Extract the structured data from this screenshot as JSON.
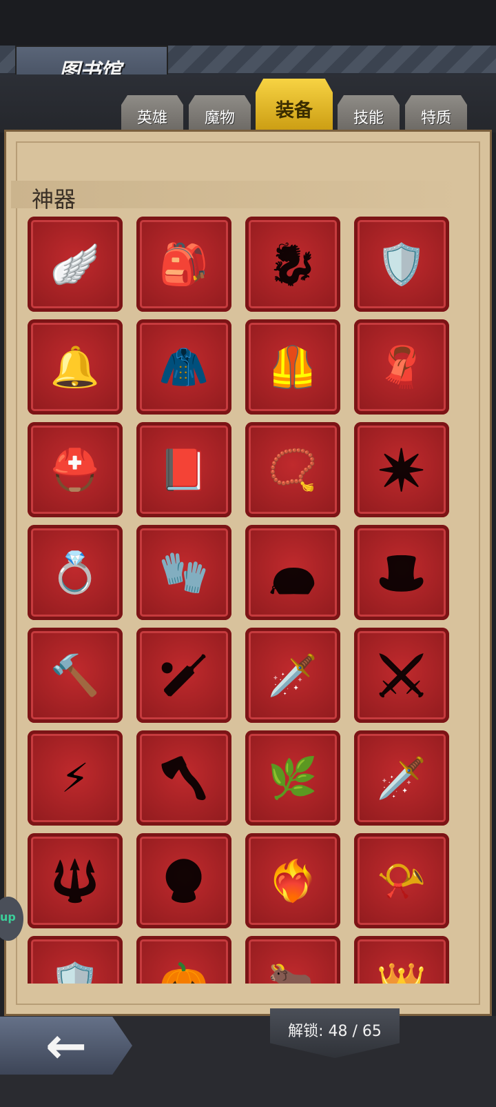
{
  "header": {
    "title": "图书馆"
  },
  "tabs": [
    {
      "label": "英雄",
      "active": false
    },
    {
      "label": "魔物",
      "active": false
    },
    {
      "label": "装备",
      "active": true
    },
    {
      "label": "技能",
      "active": false
    },
    {
      "label": "特质",
      "active": false
    }
  ],
  "section": {
    "title": "神器"
  },
  "items": [
    {
      "name": "winged-staff",
      "locked": false,
      "glyph": "🪽"
    },
    {
      "name": "backpack",
      "locked": false,
      "glyph": "🎒"
    },
    {
      "name": "dragon-silhouette",
      "locked": true,
      "glyph": "🐉"
    },
    {
      "name": "crystal-shield",
      "locked": false,
      "glyph": "🛡️"
    },
    {
      "name": "silver-bell",
      "locked": false,
      "glyph": "🔔"
    },
    {
      "name": "golden-hood",
      "locked": false,
      "glyph": "🧥"
    },
    {
      "name": "fur-armor",
      "locked": false,
      "glyph": "🦺"
    },
    {
      "name": "mantle",
      "locked": false,
      "glyph": "🧣"
    },
    {
      "name": "golden-helm",
      "locked": false,
      "glyph": "⛑️"
    },
    {
      "name": "gem-book",
      "locked": false,
      "glyph": "📕"
    },
    {
      "name": "ruby-amulet",
      "locked": false,
      "glyph": "📿"
    },
    {
      "name": "shuriken-silhouette",
      "locked": true,
      "glyph": "✴️"
    },
    {
      "name": "gem-ring",
      "locked": false,
      "glyph": "💍"
    },
    {
      "name": "spirit-gauntlet",
      "locked": false,
      "glyph": "🧤"
    },
    {
      "name": "bag-silhouette",
      "locked": true,
      "glyph": "👝"
    },
    {
      "name": "hat-silhouette",
      "locked": true,
      "glyph": "🎩"
    },
    {
      "name": "war-hammer",
      "locked": false,
      "glyph": "🔨"
    },
    {
      "name": "club-silhouette",
      "locked": true,
      "glyph": "🏏"
    },
    {
      "name": "poison-dagger",
      "locked": false,
      "glyph": "🗡️"
    },
    {
      "name": "thorn-blade-silhouette",
      "locked": true,
      "glyph": "⚔️"
    },
    {
      "name": "lightning-spear",
      "locked": false,
      "glyph": "⚡"
    },
    {
      "name": "axe-silhouette",
      "locked": true,
      "glyph": "🪓"
    },
    {
      "name": "emerald-blade",
      "locked": false,
      "glyph": "🌿"
    },
    {
      "name": "crimson-sword",
      "locked": false,
      "glyph": "🗡️"
    },
    {
      "name": "scepter-silhouette",
      "locked": true,
      "glyph": "🔱"
    },
    {
      "name": "orb-silhouette",
      "locked": true,
      "glyph": "🔮"
    },
    {
      "name": "fire-heart",
      "locked": false,
      "glyph": "❤️‍🔥"
    },
    {
      "name": "drinking-horn",
      "locked": false,
      "glyph": "📯"
    },
    {
      "name": "spiked-shield",
      "locked": false,
      "glyph": "🛡️"
    },
    {
      "name": "pumpkin",
      "locked": false,
      "glyph": "🎃"
    },
    {
      "name": "horned-helm",
      "locked": false,
      "glyph": "🐂"
    },
    {
      "name": "royal-crest",
      "locked": false,
      "glyph": "👑"
    }
  ],
  "footer": {
    "back_icon": "←",
    "unlock_text": "解锁: 48 / 65"
  },
  "side": {
    "bubble_text": "up"
  }
}
